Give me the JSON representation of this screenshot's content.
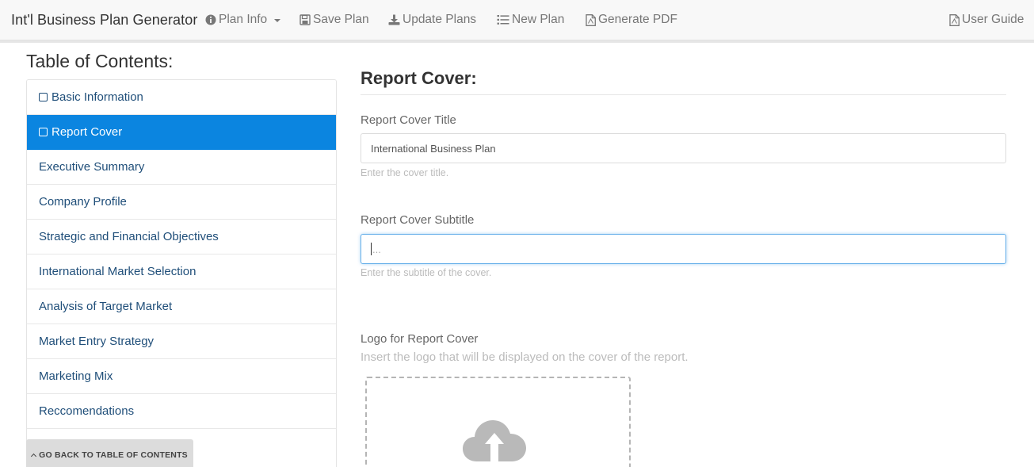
{
  "navbar": {
    "brand": "Int'l Business Plan Generator",
    "items": [
      {
        "label": "Plan Info",
        "icon": "info-circle-icon",
        "dropdown": true
      },
      {
        "label": "Save Plan",
        "icon": "floppy-disk-icon"
      },
      {
        "label": "Update Plans",
        "icon": "download-icon"
      },
      {
        "label": "New Plan",
        "icon": "list-icon"
      },
      {
        "label": "Generate PDF",
        "icon": "pdf-file-icon"
      }
    ],
    "user_guide": {
      "label": "User Guide",
      "icon": "pdf-file-icon"
    }
  },
  "sidebar": {
    "title": "Table of Contents:",
    "items": [
      {
        "label": "Basic Information",
        "checkbox": true,
        "active": false
      },
      {
        "label": "Report Cover",
        "checkbox": true,
        "active": true
      },
      {
        "label": "Executive Summary"
      },
      {
        "label": "Company Profile"
      },
      {
        "label": "Strategic and Financial Objectives"
      },
      {
        "label": "International Market Selection"
      },
      {
        "label": "Analysis of Target Market"
      },
      {
        "label": "Market Entry Strategy"
      },
      {
        "label": "Marketing Mix"
      },
      {
        "label": "Reccomendations"
      }
    ],
    "back_button": "GO BACK TO TABLE OF CONTENTS"
  },
  "main": {
    "section_title": "Report Cover:",
    "cover_title": {
      "label": "Report Cover Title",
      "value": "International Business Plan",
      "help": "Enter the cover title."
    },
    "cover_subtitle": {
      "label": "Report Cover Subtitle",
      "value": "",
      "placeholder": "...",
      "help": "Enter the subtitle of the cover."
    },
    "logo": {
      "label": "Logo for Report Cover",
      "help": "Insert the logo that will be displayed on the cover of the report.",
      "icon": "cloud-upload-icon"
    }
  },
  "colors": {
    "active_item": "#0b85e0",
    "link_text": "#1f4e79",
    "focus_border": "#66afe9"
  }
}
